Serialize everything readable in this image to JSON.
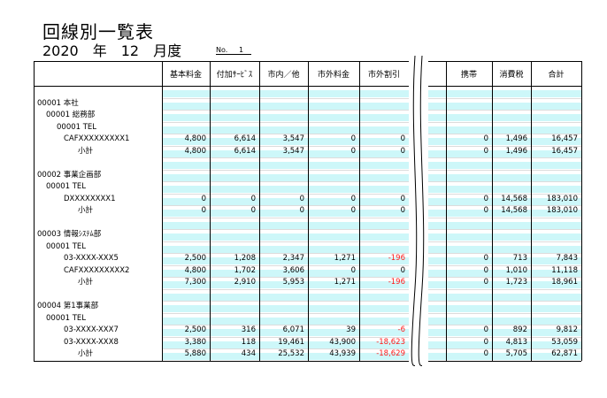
{
  "report": {
    "title": "回線別一覧表",
    "period": "2020　年　12　月度",
    "page_no": "No.     1"
  },
  "columns": [
    "基本料金",
    "付加ｻｰﾋﾞｽ",
    "市内／他",
    "市外料金",
    "市外割引",
    "携帯",
    "消費税",
    "合計"
  ],
  "rows": [
    {
      "type": "blank",
      "label": "",
      "indent": 0
    },
    {
      "type": "group",
      "label": "00001 本社",
      "indent": 0
    },
    {
      "type": "group",
      "label": "00001 総務部",
      "indent": 1
    },
    {
      "type": "group",
      "label": "00001 TEL",
      "indent": 2
    },
    {
      "type": "line",
      "label": "CAFXXXXXXXXX1",
      "indent": 3,
      "values": [
        "4,800",
        "6,614",
        "3,547",
        "0",
        "0",
        "0",
        "1,496",
        "16,457"
      ]
    },
    {
      "type": "subtotal",
      "label": "小計",
      "indent": 4,
      "values": [
        "4,800",
        "6,614",
        "3,547",
        "0",
        "0",
        "0",
        "1,496",
        "16,457"
      ]
    },
    {
      "type": "blank",
      "label": "",
      "indent": 0
    },
    {
      "type": "group",
      "label": "00002 事業企画部",
      "indent": 0
    },
    {
      "type": "group",
      "label": "00001 TEL",
      "indent": 1
    },
    {
      "type": "line",
      "label": "DXXXXXXXX1",
      "indent": 3,
      "values": [
        "0",
        "0",
        "0",
        "0",
        "0",
        "0",
        "14,568",
        "183,010"
      ]
    },
    {
      "type": "subtotal",
      "label": "小計",
      "indent": 4,
      "values": [
        "0",
        "0",
        "0",
        "0",
        "0",
        "0",
        "14,568",
        "183,010"
      ]
    },
    {
      "type": "blank",
      "label": "",
      "indent": 0
    },
    {
      "type": "group",
      "label": "00003 情報ｼｽﾃﾑ部",
      "indent": 0
    },
    {
      "type": "group",
      "label": "00001 TEL",
      "indent": 1
    },
    {
      "type": "line",
      "label": "03-XXXX-XXX5",
      "indent": 3,
      "values": [
        "2,500",
        "1,208",
        "2,347",
        "1,271",
        "-196",
        "0",
        "713",
        "7,843"
      ]
    },
    {
      "type": "line",
      "label": "CAFXXXXXXXXX2",
      "indent": 3,
      "values": [
        "4,800",
        "1,702",
        "3,606",
        "0",
        "0",
        "0",
        "1,010",
        "11,118"
      ]
    },
    {
      "type": "subtotal",
      "label": "小計",
      "indent": 4,
      "values": [
        "7,300",
        "2,910",
        "5,953",
        "1,271",
        "-196",
        "0",
        "1,723",
        "18,961"
      ]
    },
    {
      "type": "blank",
      "label": "",
      "indent": 0
    },
    {
      "type": "group",
      "label": "00004 第1事業部",
      "indent": 0
    },
    {
      "type": "group",
      "label": "00001 TEL",
      "indent": 1
    },
    {
      "type": "line",
      "label": "03-XXXX-XXX7",
      "indent": 3,
      "values": [
        "2,500",
        "316",
        "6,071",
        "39",
        "-6",
        "0",
        "892",
        "9,812"
      ]
    },
    {
      "type": "line",
      "label": "03-XXXX-XXX8",
      "indent": 3,
      "values": [
        "3,380",
        "118",
        "19,461",
        "43,900",
        "-18,623",
        "0",
        "4,813",
        "53,059"
      ]
    },
    {
      "type": "subtotal",
      "label": "小計",
      "indent": 4,
      "values": [
        "5,880",
        "434",
        "25,532",
        "43,939",
        "-18,629",
        "0",
        "5,705",
        "62,871"
      ]
    }
  ],
  "colors": {
    "band": "#cdf7f9",
    "negative": "#ff1a1a"
  }
}
